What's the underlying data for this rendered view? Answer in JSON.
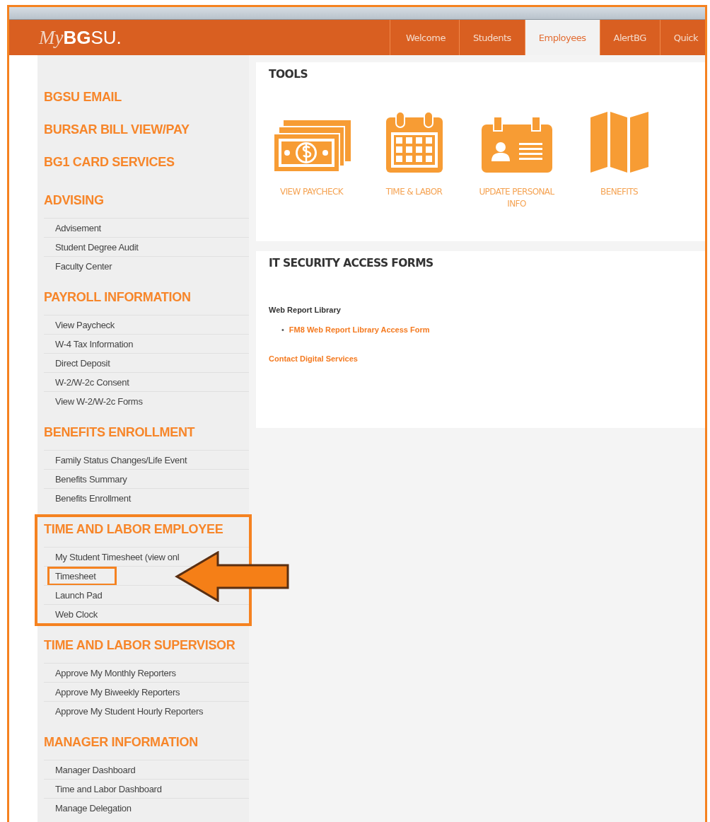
{
  "logo": {
    "script": "My",
    "bold": "BG",
    "rest": "SU."
  },
  "nav_tabs": [
    {
      "label": "Welcome",
      "selected": false
    },
    {
      "label": "Students",
      "selected": false
    },
    {
      "label": "Employees",
      "selected": true
    },
    {
      "label": "AlertBG",
      "selected": false
    },
    {
      "label": "Quick",
      "selected": false
    }
  ],
  "sidebar": {
    "links": [
      "BGSU EMAIL",
      "BURSAR BILL VIEW/PAY",
      "BG1 CARD SERVICES"
    ],
    "sections": [
      {
        "title": "ADVISING",
        "highlighted": false,
        "items": [
          {
            "label": "Advisement",
            "highlighted": false
          },
          {
            "label": "Student Degree Audit",
            "highlighted": false
          },
          {
            "label": "Faculty Center",
            "highlighted": false
          }
        ]
      },
      {
        "title": "PAYROLL INFORMATION",
        "highlighted": false,
        "items": [
          {
            "label": "View Paycheck",
            "highlighted": false
          },
          {
            "label": "W-4 Tax Information",
            "highlighted": false
          },
          {
            "label": "Direct Deposit",
            "highlighted": false
          },
          {
            "label": "W-2/W-2c Consent",
            "highlighted": false
          },
          {
            "label": "View W-2/W-2c Forms",
            "highlighted": false
          }
        ]
      },
      {
        "title": "BENEFITS ENROLLMENT",
        "highlighted": false,
        "items": [
          {
            "label": "Family Status Changes/Life Event",
            "highlighted": false
          },
          {
            "label": "Benefits Summary",
            "highlighted": false
          },
          {
            "label": "Benefits Enrollment",
            "highlighted": false
          }
        ]
      },
      {
        "title": "TIME AND LABOR EMPLOYEE",
        "highlighted": true,
        "items": [
          {
            "label": "My Student Timesheet (view onl",
            "highlighted": false
          },
          {
            "label": "Timesheet",
            "highlighted": true
          },
          {
            "label": "Launch Pad",
            "highlighted": false
          },
          {
            "label": "Web Clock",
            "highlighted": false
          }
        ]
      },
      {
        "title": "TIME AND LABOR SUPERVISOR",
        "highlighted": false,
        "items": [
          {
            "label": "Approve My Monthly Reporters",
            "highlighted": false
          },
          {
            "label": "Approve My Biweekly Reporters",
            "highlighted": false
          },
          {
            "label": "Approve My Student Hourly Reporters",
            "highlighted": false
          }
        ]
      },
      {
        "title": "MANAGER INFORMATION",
        "highlighted": false,
        "items": [
          {
            "label": "Manager Dashboard",
            "highlighted": false
          },
          {
            "label": "Time and Labor Dashboard",
            "highlighted": false
          },
          {
            "label": "Manage Delegation",
            "highlighted": false
          }
        ]
      }
    ]
  },
  "tools": {
    "title": "TOOLS",
    "items": [
      {
        "label": "VIEW PAYCHECK",
        "kind": "money"
      },
      {
        "label": "TIME & LABOR",
        "kind": "calendar"
      },
      {
        "label": "UPDATE PERSONAL INFO",
        "kind": "id-card"
      },
      {
        "label": "BENEFITS",
        "kind": "map"
      }
    ]
  },
  "forms": {
    "title": "IT SECURITY ACCESS FORMS",
    "groups": [
      {
        "heading": "Web Report Library",
        "marker": "•",
        "links": [
          "FM8 Web Report Library Access Form"
        ]
      }
    ],
    "contact": "Contact Digital Services"
  }
}
